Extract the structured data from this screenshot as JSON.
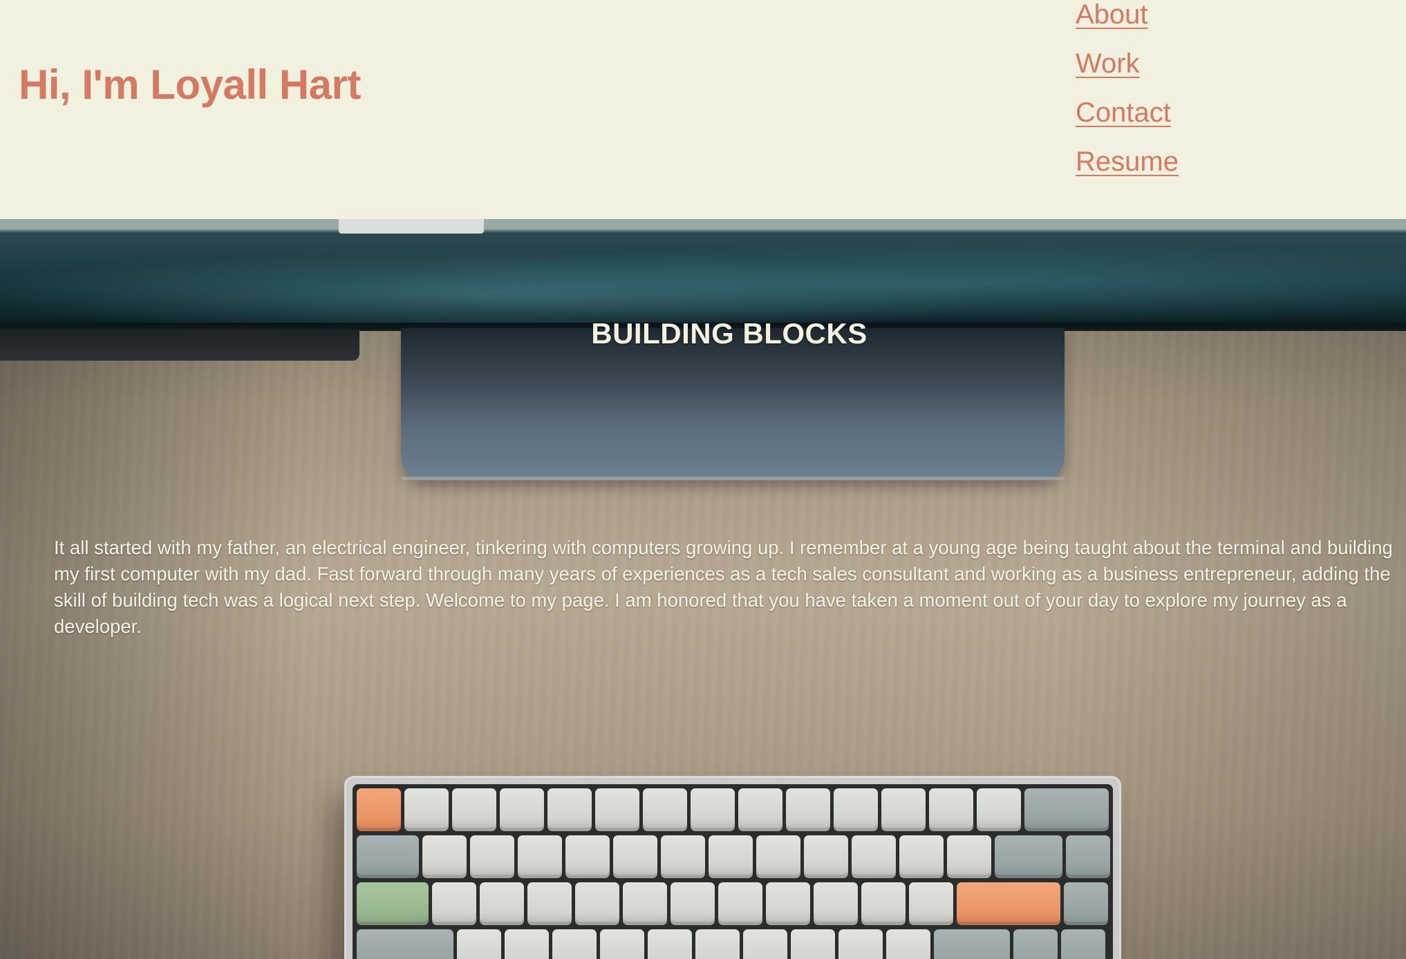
{
  "header": {
    "title": "Hi, I'm Loyall Hart",
    "nav": [
      {
        "label": "About"
      },
      {
        "label": "Work"
      },
      {
        "label": "Contact"
      },
      {
        "label": "Resume"
      }
    ]
  },
  "hero": {
    "section_title": "BUILDING BLOCKS",
    "intro": "It all started with my father, an electrical engineer, tinkering with computers growing up. I remember at a young age being taught about the terminal and building my first computer with my dad. Fast forward through many years of experiences as a tech sales consultant and working as a business entrepreneur, adding the skill of building tech was a logical next step. Welcome to my page. I am honored that you have taken a moment out of your day to explore my journey as a developer."
  },
  "colors": {
    "background": "#f2f0de",
    "accent": "#d47a63",
    "hero_text": "#f4f1de"
  }
}
